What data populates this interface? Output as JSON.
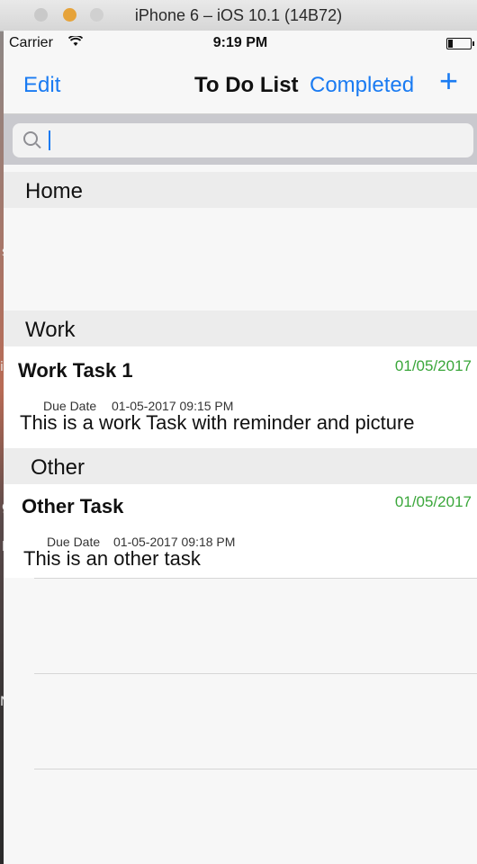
{
  "window": {
    "title": "iPhone 6 – iOS 10.1 (14B72)"
  },
  "status": {
    "carrier": "Carrier",
    "time": "9:19 PM"
  },
  "nav": {
    "edit": "Edit",
    "title": "To Do List",
    "completed": "Completed",
    "add": "+"
  },
  "search": {
    "placeholder": "",
    "value": ""
  },
  "sections": {
    "home": "Home",
    "work": "Work",
    "other": "Other"
  },
  "tasks": [
    {
      "title": "Work Task 1",
      "date": "01/05/2017",
      "due_label": "Due Date",
      "due_value": "01-05-2017 09:15 PM",
      "description": "This is a work Task with reminder and picture"
    },
    {
      "title": "Other Task",
      "date": "01/05/2017",
      "due_label": "Due Date",
      "due_value": "01-05-2017 09:18 PM",
      "description": "This is an other task"
    }
  ],
  "desktop": {
    "fragments": [
      "s",
      "ig",
      "g",
      "lig",
      "No",
      "m"
    ]
  }
}
